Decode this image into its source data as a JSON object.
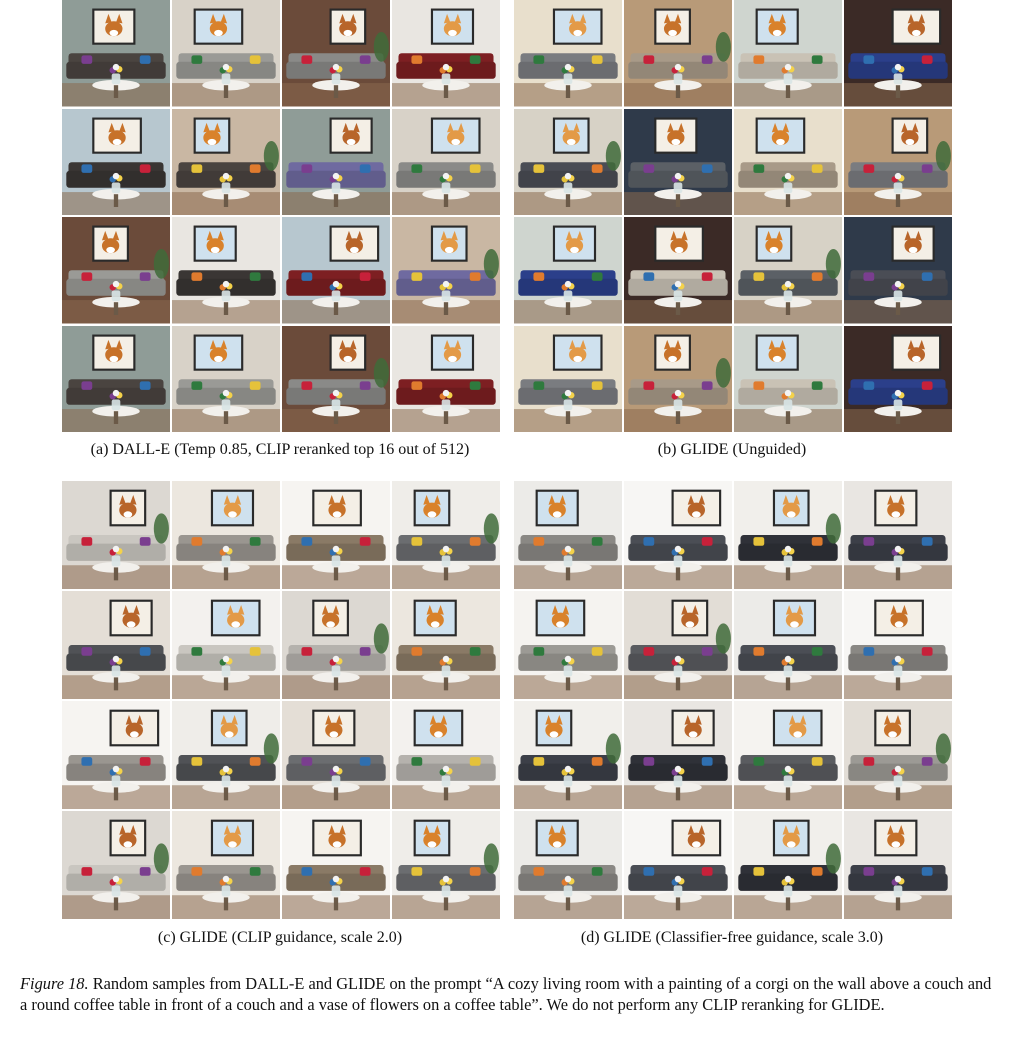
{
  "panels": [
    {
      "id": "a",
      "caption": "(a) DALL-E (Temp 0.85, CLIP reranked top 16 out of 512)",
      "sample_count": 16
    },
    {
      "id": "b",
      "caption": "(b) GLIDE (Unguided)",
      "sample_count": 16
    },
    {
      "id": "c",
      "caption": "(c) GLIDE (CLIP guidance, scale 2.0)",
      "sample_count": 16
    },
    {
      "id": "d",
      "caption": "(d) GLIDE (Classifier-free guidance, scale 3.0)",
      "sample_count": 16
    }
  ],
  "figure_caption": {
    "label": "Figure 18.",
    "text": " Random samples from DALL-E and GLIDE on the prompt “A cozy living room with a painting of a corgi on the wall above a couch and a round coffee table in front of a couch and a vase of flowers on a coffee table”. We do not perform any CLIP reranking for GLIDE."
  },
  "palette": {
    "a": {
      "wall": [
        "#c9b7a3",
        "#8f9c97",
        "#d8d2c8",
        "#6b4b3a",
        "#e9e6e1",
        "#b7c7cf"
      ],
      "couch": [
        "#4a4440",
        "#8a8a88",
        "#3a3634",
        "#6f6aa0",
        "#9a9a96",
        "#7d1f22"
      ]
    },
    "b": {
      "wall": [
        "#d7d2c6",
        "#2f3a4a",
        "#e8dfcc",
        "#b89a78",
        "#cfd5cf",
        "#3b2a26"
      ],
      "couch": [
        "#5b6066",
        "#7a7c80",
        "#c9c2b5",
        "#4a4d55",
        "#a89a88",
        "#2b3f8a"
      ]
    },
    "c": {
      "wall": [
        "#efede9",
        "#e4ded6",
        "#f3f1ee",
        "#dcd8d2",
        "#ece7df",
        "#f6f4f1"
      ],
      "couch": [
        "#6b6d70",
        "#c9c6c0",
        "#8a7a66",
        "#505256",
        "#b5b2ad",
        "#9a9690"
      ]
    },
    "d": {
      "wall": [
        "#f1efeb",
        "#e9e6e2",
        "#f5f3f0",
        "#e2ddd6",
        "#ecebe8",
        "#f7f6f4"
      ],
      "couch": [
        "#3c3f48",
        "#5a5c60",
        "#8a8884",
        "#2f3138",
        "#9c9a95",
        "#4b4e55"
      ]
    },
    "corgi": [
      "#d9822b",
      "#c7722a",
      "#e39a47",
      "#b8652a"
    ],
    "accent": [
      "#c7213a",
      "#e07b2e",
      "#2f6fb0",
      "#e5c23a",
      "#7a3e8f",
      "#2f7a3e"
    ]
  }
}
